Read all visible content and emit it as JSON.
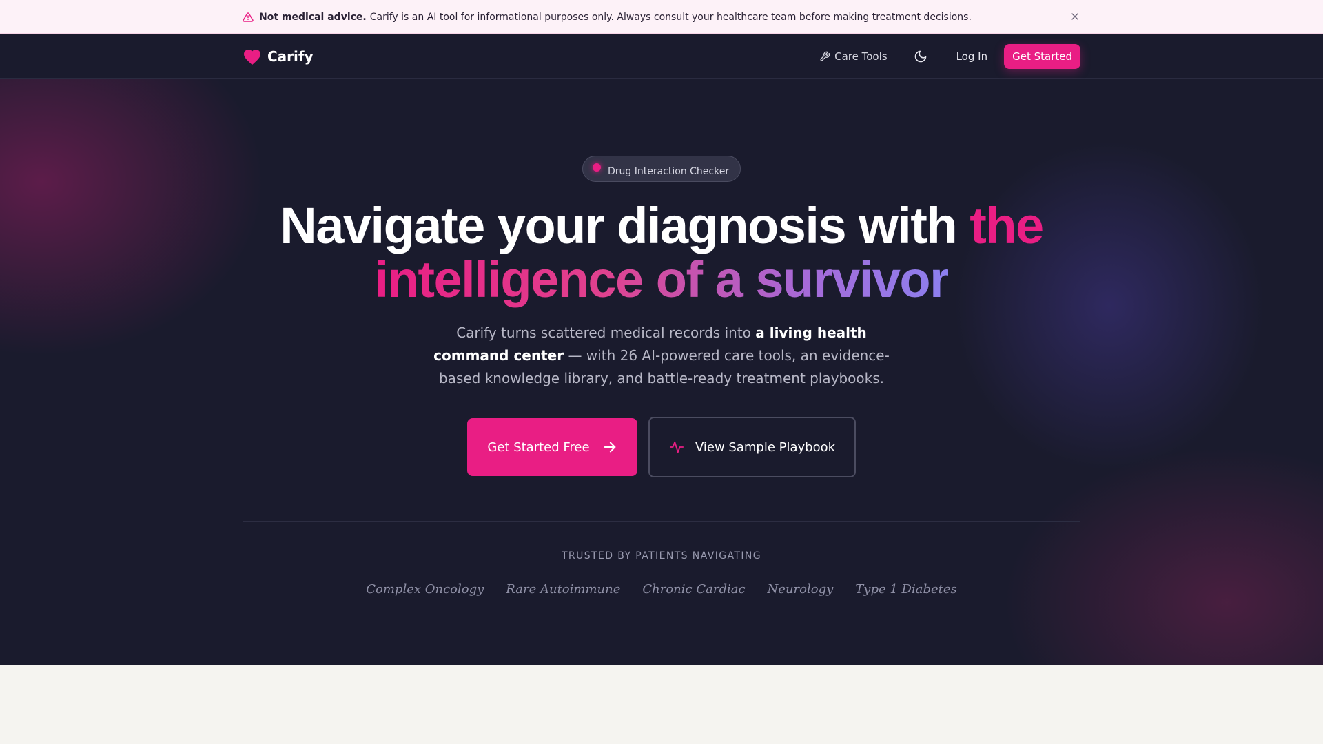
{
  "banner": {
    "title": "Not medical advice.",
    "message": "Carify is an AI tool for informational purposes only. Always consult your healthcare team before making treatment decisions.",
    "icon": "alert-triangle-icon",
    "close_icon": "close-icon"
  },
  "nav": {
    "brand": "Carify",
    "brand_icon": "heart-icon",
    "care_tools": "Care Tools",
    "care_tools_icon": "wrench-icon",
    "theme_icon": "moon-icon",
    "login": "Log In",
    "get_started": "Get Started"
  },
  "hero": {
    "pill": "Drug Interaction Checker",
    "headline_part1": "Navigate your diagnosis with ",
    "headline_part2": "the",
    "headline_line2": "intelligence of a survivor",
    "sub_part1": "Carify turns scattered medical records into ",
    "sub_strong": "a living health command center",
    "sub_part2": " — with 26 AI-powered care tools, an evidence-based knowledge library, and battle-ready treatment playbooks.",
    "primary_cta": "Get Started Free",
    "primary_cta_icon": "arrow-right-icon",
    "secondary_cta": "View Sample Playbook",
    "secondary_cta_icon": "activity-pulse-icon",
    "trusted_heading": "TRUSTED BY PATIENTS NAVIGATING",
    "conditions": [
      "Complex Oncology",
      "Rare Autoimmune",
      "Chronic Cardiac",
      "Neurology",
      "Type 1 Diabetes"
    ]
  },
  "colors": {
    "accent": "#e91e84",
    "navy": "#1a1b2d",
    "banner_bg": "#fdf2f8",
    "gradient_end": "#8c80f0"
  }
}
